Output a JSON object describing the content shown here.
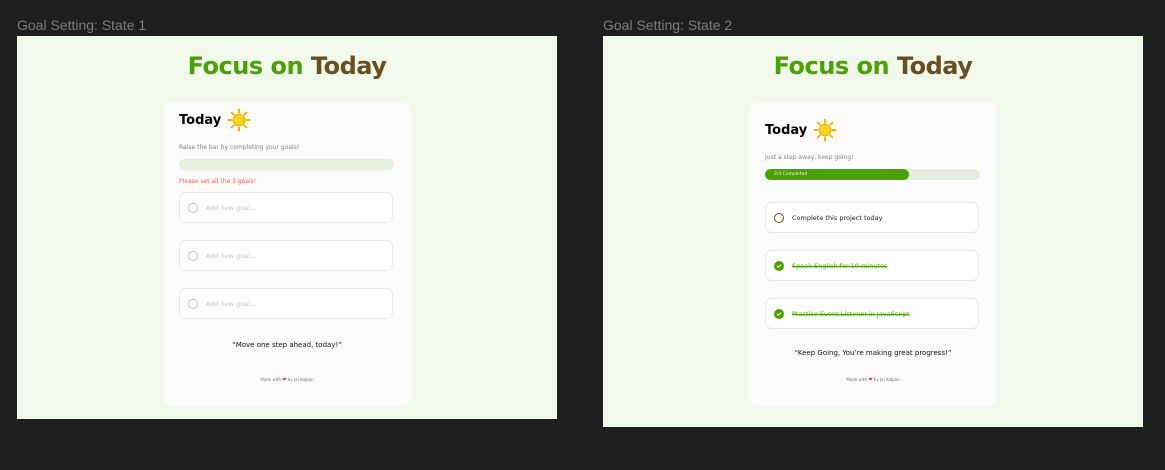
{
  "frames": [
    {
      "label": "Goal Setting: State 1",
      "title_part1": "Focus on",
      "title_part2": "Today",
      "card_title": "Today",
      "subtext": "Raise the bar by completing your goals!",
      "progress": 0,
      "progress_text": "",
      "error": "Please set all the 3 goals!",
      "goals": [
        {
          "text": "Add new goal...",
          "state": "placeholder"
        },
        {
          "text": "Add new goal...",
          "state": "placeholder"
        },
        {
          "text": "Add new goal...",
          "state": "placeholder"
        }
      ],
      "quote": "“Move one step ahead, today!”",
      "footer_pre": "Made with",
      "footer_post": "by Jai Kalpan"
    },
    {
      "label": "Goal Setting: State 2",
      "title_part1": "Focus on",
      "title_part2": "Today",
      "card_title": "Today",
      "subtext": "Just a step away, keep going!",
      "progress": 0.67,
      "progress_text": "2/3 Completed",
      "goals": [
        {
          "text": "Complete this project today",
          "state": "open"
        },
        {
          "text": "Speak English for 10 minutes",
          "state": "done"
        },
        {
          "text": "Practice Event Listener in JavaScript",
          "state": "done"
        }
      ],
      "quote": "“Keep Going, You’re making great progress!”",
      "footer_pre": "Made with",
      "footer_post": "by Jai Kalpan"
    }
  ],
  "colors": {
    "accent": "#48a300",
    "brown": "#6a4d21",
    "frame_bg": "#f1f9ea",
    "error": "#ff5d5d"
  },
  "icons": {
    "card_icon": "sun-icon",
    "footer_icon": "heart-icon",
    "done_icon": "check-circle-icon"
  }
}
